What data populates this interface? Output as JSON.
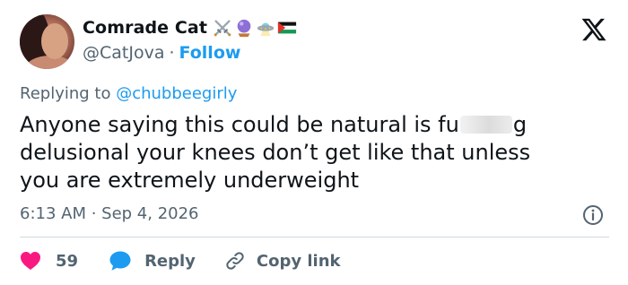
{
  "author": {
    "display_name": "Comrade Cat",
    "handle": "@CatJova",
    "separator": "·",
    "follow_label": "Follow",
    "badges": [
      "crossed-swords-icon",
      "crystal-ball-icon",
      "flying-saucer-icon",
      "palestine-flag-icon"
    ]
  },
  "reply_context": {
    "prefix": "Replying to",
    "mention": "@chubbeegirly"
  },
  "tweet": {
    "line1_before": "Anyone saying this could be natural is fu",
    "line1_after": "g",
    "line2": "delusional your knees don’t get like that unless",
    "line3": "you are extremely underweight",
    "timestamp": "6:13 AM · Sep 4, 2026"
  },
  "actions": {
    "like_count": "59",
    "reply_label": "Reply",
    "copy_link_label": "Copy link"
  },
  "colors": {
    "like": "#f91880",
    "reply": "#1d9bf0",
    "link": "#1d9bf0",
    "muted": "#536471",
    "text": "#0f1419"
  }
}
